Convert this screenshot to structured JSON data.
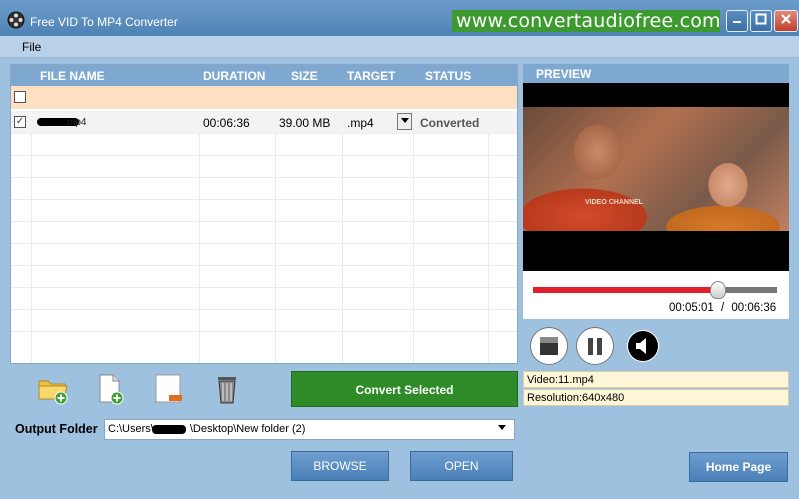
{
  "window": {
    "title": "Free VID To MP4 Converter",
    "banner": "www.convertaudiofree.com"
  },
  "menu": {
    "file": "File"
  },
  "table": {
    "headers": {
      "file_name": "FILE NAME",
      "duration": "DURATION",
      "size": "SIZE",
      "target": "TARGET",
      "status": "STATUS"
    },
    "rows": [
      {
        "file_name_suffix": "mp4",
        "duration": "00:06:36",
        "size": "39.00 MB",
        "target": ".mp4",
        "status": "Converted",
        "checked": true
      }
    ]
  },
  "toolbar": {
    "icons": [
      "add-folder-icon",
      "add-file-icon",
      "remove-file-icon",
      "trash-icon"
    ],
    "convert_label": "Convert Selected"
  },
  "output": {
    "label": "Output Folder",
    "path_start": "C:\\Users\\",
    "path_end": "\\Desktop\\New folder (2)"
  },
  "buttons": {
    "browse": "BROWSE",
    "open": "OPEN",
    "home": "Home Page"
  },
  "preview": {
    "header": "PREVIEW",
    "watermark": "VIDEO CHANNEL",
    "current_time": "00:05:01",
    "separator": "/",
    "total_time": "00:06:36",
    "progress": 0.76,
    "video_info": "Video:11.mp4",
    "resolution_info": "Resolution:640x480"
  },
  "colors": {
    "convert_green": "#2f8a28",
    "header_blue": "#7fa8d0",
    "seek_red": "#e0202a",
    "banner_green": "#3c9a2f"
  }
}
